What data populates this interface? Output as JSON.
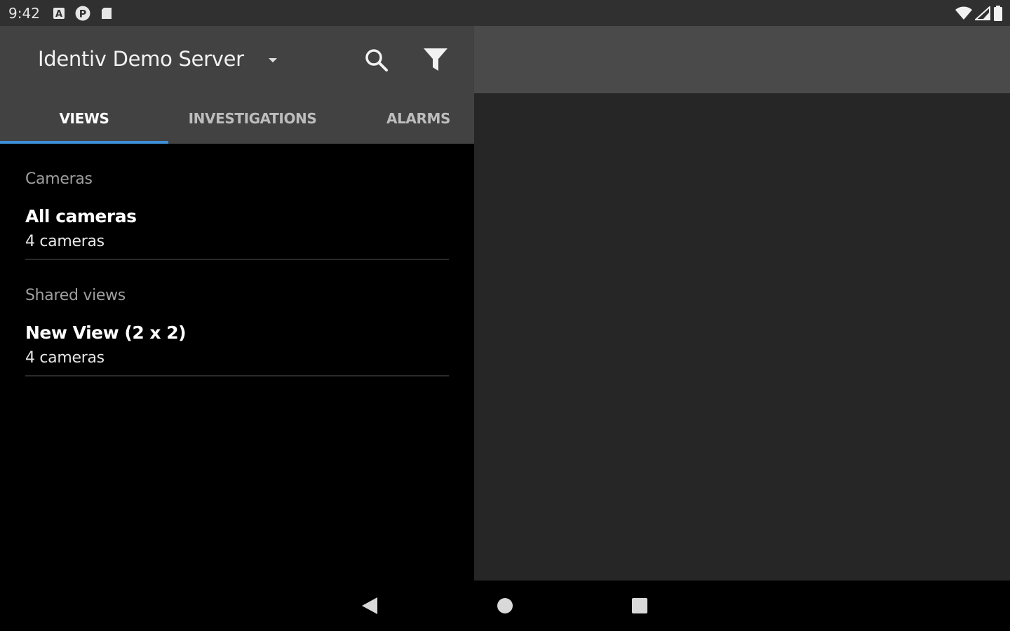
{
  "status_bar": {
    "time": "9:42",
    "icons_left": [
      "a-box-icon",
      "parking-icon",
      "sd-card-icon"
    ],
    "icons_right": [
      "wifi-icon",
      "cell-signal-icon",
      "battery-icon"
    ]
  },
  "appbar": {
    "server_name": "Identiv Demo Server",
    "icons": [
      "dropdown-icon",
      "search-icon",
      "filter-icon"
    ]
  },
  "tabs": [
    {
      "label": "VIEWS",
      "active": true
    },
    {
      "label": "INVESTIGATIONS",
      "active": false
    },
    {
      "label": "ALARMS",
      "active": false
    }
  ],
  "sections": [
    {
      "label": "Cameras",
      "items": [
        {
          "title": "All cameras",
          "subtitle": "4 cameras"
        }
      ]
    },
    {
      "label": "Shared views",
      "items": [
        {
          "title": "New View (2 x 2)",
          "subtitle": "4 cameras"
        }
      ]
    }
  ],
  "navbar": {
    "icons": [
      "back-icon",
      "home-icon",
      "recents-icon"
    ]
  },
  "colors": {
    "status_bar": "#303030",
    "appbar": "#424242",
    "tab_indicator": "#3f8ed8",
    "right_top": "#4a4a4a",
    "right_body": "#262626",
    "background": "#000000"
  }
}
